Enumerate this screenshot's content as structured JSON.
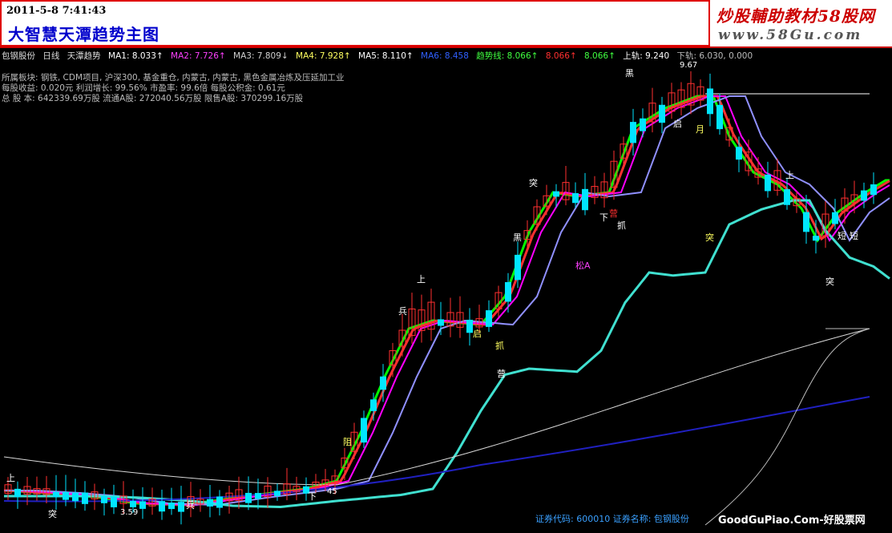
{
  "header": {
    "datetime": "2011-5-8 7:41:43",
    "title": "大智慧天潭趋势主图",
    "brand_name": "炒股輔助教材58股网",
    "brand_url": "www.58Gu.com"
  },
  "stock_line": {
    "name": "包钢股份",
    "period": "日线",
    "indicator": "天潭趋势",
    "ma1": "MA1: 8.033↑",
    "ma2": "MA2: 7.726↑",
    "ma3": "MA3: 7.809↓",
    "ma4": "MA4: 7.928↑",
    "ma5": "MA5: 8.110↑",
    "ma6": "MA6: 8.458",
    "trend": "趋势线: 8.066↑",
    "trend2": "8.066↑",
    "trend3": "8.066↑",
    "upper": "上轨: 9.240",
    "lower": "下轨: 6.030, 0.000"
  },
  "info": {
    "sector": "所属板块: 钢铁, CDM项目, 沪深300, 基金重仓, 内蒙古, 内蒙古, 黑色金属冶炼及压延加工业",
    "eps": "每股收益: 0.020元    利润增长: 99.56%    市盈率: 99.6倍    每股公积金: 0.61元",
    "shares": "总 股 本: 642339.69万股  流通A股: 272040.56万股  限售A股: 370299.16万股"
  },
  "footer": {
    "code": "证券代码: 600010  证券名称: 包钢股份",
    "site": "GoodGuPiao.Com-好股票网"
  },
  "chart_labels": {
    "high_value": "9.67",
    "low_value": "3.59",
    "mid_value": "45",
    "signals": [
      "上",
      "黑",
      "突",
      "兵",
      "启",
      "营",
      "抓",
      "阻",
      "短",
      "松A",
      "下",
      "月",
      "突",
      "黑",
      "上",
      "兵",
      "突",
      "营",
      "抓",
      "下",
      "启",
      "上",
      "突",
      "短"
    ]
  },
  "colors": {
    "up": "#ff3030",
    "down": "#00e5ff",
    "ma1": "#ffffff",
    "ma2": "#ff3030",
    "ma3": "#00ff00",
    "ma4": "#ff00ff",
    "ma5": "#9090ff",
    "ma6": "#40e0d0",
    "ma7": "#d8d8d8",
    "ma8": "#2020c0",
    "upper_line": "#ffffff"
  }
}
